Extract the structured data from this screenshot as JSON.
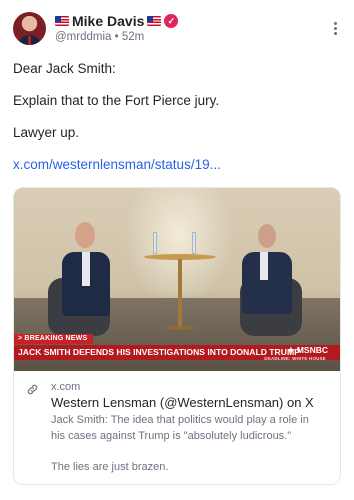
{
  "author": {
    "name": "Mike Davis",
    "handle": "@mrddmia",
    "separator": "•",
    "time": "52m",
    "flags": [
      "us-flag-icon",
      "us-flag-icon"
    ],
    "verified_icon": "verified-badge-icon"
  },
  "post": {
    "lines": [
      "Dear Jack Smith:",
      "Explain that to the Fort Pierce jury.",
      "Lawyer up."
    ],
    "link_text": "x.com/westernlensman/status/19..."
  },
  "card": {
    "domain": "x.com",
    "title": "Western Lensman (@WesternLensman) on X",
    "description_lines": [
      "Jack Smith: The idea that politics would play a role in his cases against Trump is \"absolutely ludicrous.\"",
      "The lies are just brazen."
    ],
    "media": {
      "breaking_label": "> BREAKING NEWS",
      "headline": "JACK SMITH DEFENDS HIS INVESTIGATIONS INTO DONALD TRUMP",
      "network": "MSNBC",
      "subtext": "DEADLINE: WHITE HOUSE"
    }
  },
  "colors": {
    "link": "#2563eb",
    "verified": "#e0245e",
    "ticker": "#b31a1f"
  }
}
